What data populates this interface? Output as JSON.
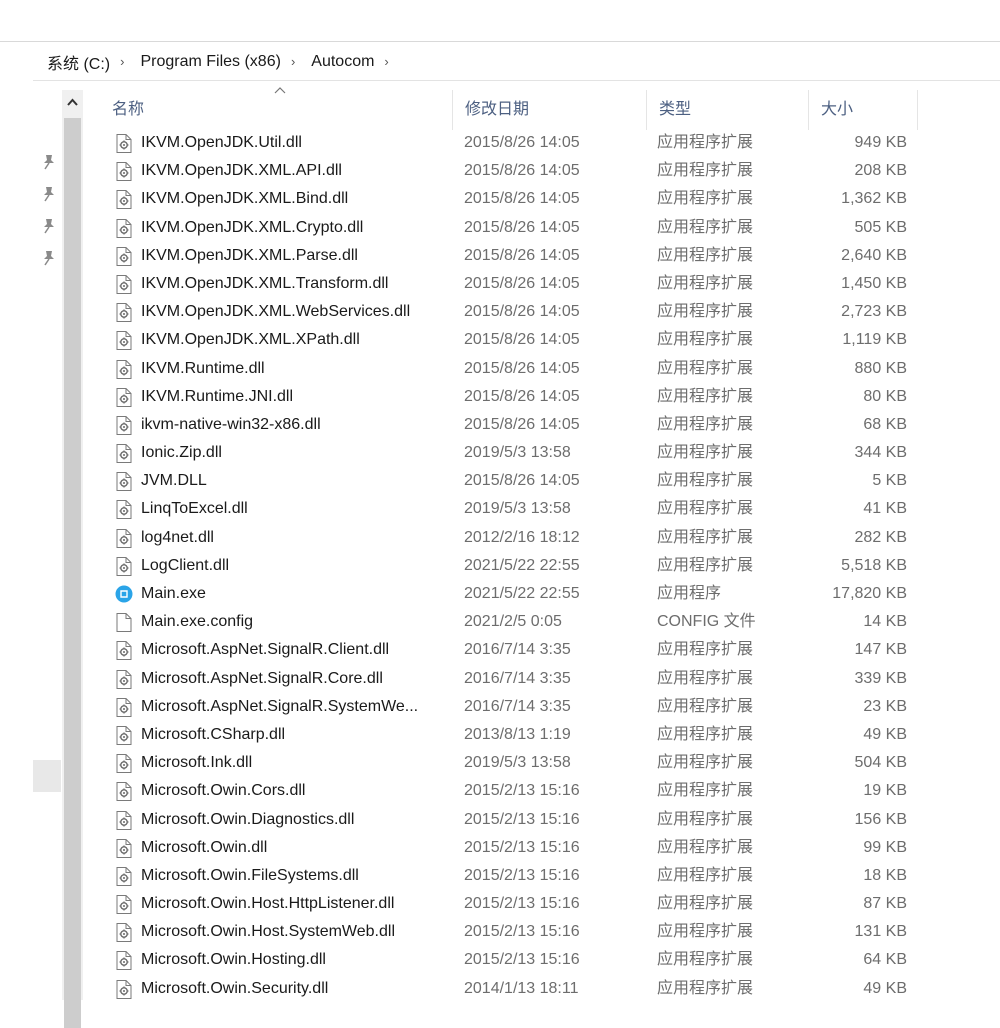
{
  "breadcrumb": {
    "items": [
      "系统 (C:)",
      "Program Files (x86)",
      "Autocom"
    ],
    "separator": "›"
  },
  "header": {
    "name": "名称",
    "date": "修改日期",
    "type": "类型",
    "size": "大小"
  },
  "colors": {
    "header_text": "#4d6082",
    "meta_text": "#6d6d6d",
    "exe_icon": "#2aa4e8"
  },
  "files": [
    {
      "name": "IKVM.OpenJDK.Util.dll",
      "date": "2015/8/26 14:05",
      "type": "应用程序扩展",
      "size": "949 KB",
      "icon": "dll-icon"
    },
    {
      "name": "IKVM.OpenJDK.XML.API.dll",
      "date": "2015/8/26 14:05",
      "type": "应用程序扩展",
      "size": "208 KB",
      "icon": "dll-icon"
    },
    {
      "name": "IKVM.OpenJDK.XML.Bind.dll",
      "date": "2015/8/26 14:05",
      "type": "应用程序扩展",
      "size": "1,362 KB",
      "icon": "dll-icon"
    },
    {
      "name": "IKVM.OpenJDK.XML.Crypto.dll",
      "date": "2015/8/26 14:05",
      "type": "应用程序扩展",
      "size": "505 KB",
      "icon": "dll-icon"
    },
    {
      "name": "IKVM.OpenJDK.XML.Parse.dll",
      "date": "2015/8/26 14:05",
      "type": "应用程序扩展",
      "size": "2,640 KB",
      "icon": "dll-icon"
    },
    {
      "name": "IKVM.OpenJDK.XML.Transform.dll",
      "date": "2015/8/26 14:05",
      "type": "应用程序扩展",
      "size": "1,450 KB",
      "icon": "dll-icon"
    },
    {
      "name": "IKVM.OpenJDK.XML.WebServices.dll",
      "date": "2015/8/26 14:05",
      "type": "应用程序扩展",
      "size": "2,723 KB",
      "icon": "dll-icon"
    },
    {
      "name": "IKVM.OpenJDK.XML.XPath.dll",
      "date": "2015/8/26 14:05",
      "type": "应用程序扩展",
      "size": "1,119 KB",
      "icon": "dll-icon"
    },
    {
      "name": "IKVM.Runtime.dll",
      "date": "2015/8/26 14:05",
      "type": "应用程序扩展",
      "size": "880 KB",
      "icon": "dll-icon"
    },
    {
      "name": "IKVM.Runtime.JNI.dll",
      "date": "2015/8/26 14:05",
      "type": "应用程序扩展",
      "size": "80 KB",
      "icon": "dll-icon"
    },
    {
      "name": "ikvm-native-win32-x86.dll",
      "date": "2015/8/26 14:05",
      "type": "应用程序扩展",
      "size": "68 KB",
      "icon": "dll-icon"
    },
    {
      "name": "Ionic.Zip.dll",
      "date": "2019/5/3 13:58",
      "type": "应用程序扩展",
      "size": "344 KB",
      "icon": "dll-icon"
    },
    {
      "name": "JVM.DLL",
      "date": "2015/8/26 14:05",
      "type": "应用程序扩展",
      "size": "5 KB",
      "icon": "dll-icon"
    },
    {
      "name": "LinqToExcel.dll",
      "date": "2019/5/3 13:58",
      "type": "应用程序扩展",
      "size": "41 KB",
      "icon": "dll-icon"
    },
    {
      "name": "log4net.dll",
      "date": "2012/2/16 18:12",
      "type": "应用程序扩展",
      "size": "282 KB",
      "icon": "dll-icon"
    },
    {
      "name": "LogClient.dll",
      "date": "2021/5/22 22:55",
      "type": "应用程序扩展",
      "size": "5,518 KB",
      "icon": "dll-icon"
    },
    {
      "name": "Main.exe",
      "date": "2021/5/22 22:55",
      "type": "应用程序",
      "size": "17,820 KB",
      "icon": "exe-icon"
    },
    {
      "name": "Main.exe.config",
      "date": "2021/2/5 0:05",
      "type": "CONFIG 文件",
      "size": "14 KB",
      "icon": "file-icon"
    },
    {
      "name": "Microsoft.AspNet.SignalR.Client.dll",
      "date": "2016/7/14 3:35",
      "type": "应用程序扩展",
      "size": "147 KB",
      "icon": "dll-icon"
    },
    {
      "name": "Microsoft.AspNet.SignalR.Core.dll",
      "date": "2016/7/14 3:35",
      "type": "应用程序扩展",
      "size": "339 KB",
      "icon": "dll-icon"
    },
    {
      "name": "Microsoft.AspNet.SignalR.SystemWe...",
      "date": "2016/7/14 3:35",
      "type": "应用程序扩展",
      "size": "23 KB",
      "icon": "dll-icon"
    },
    {
      "name": "Microsoft.CSharp.dll",
      "date": "2013/8/13 1:19",
      "type": "应用程序扩展",
      "size": "49 KB",
      "icon": "dll-icon"
    },
    {
      "name": "Microsoft.Ink.dll",
      "date": "2019/5/3 13:58",
      "type": "应用程序扩展",
      "size": "504 KB",
      "icon": "dll-icon"
    },
    {
      "name": "Microsoft.Owin.Cors.dll",
      "date": "2015/2/13 15:16",
      "type": "应用程序扩展",
      "size": "19 KB",
      "icon": "dll-icon"
    },
    {
      "name": "Microsoft.Owin.Diagnostics.dll",
      "date": "2015/2/13 15:16",
      "type": "应用程序扩展",
      "size": "156 KB",
      "icon": "dll-icon"
    },
    {
      "name": "Microsoft.Owin.dll",
      "date": "2015/2/13 15:16",
      "type": "应用程序扩展",
      "size": "99 KB",
      "icon": "dll-icon"
    },
    {
      "name": "Microsoft.Owin.FileSystems.dll",
      "date": "2015/2/13 15:16",
      "type": "应用程序扩展",
      "size": "18 KB",
      "icon": "dll-icon"
    },
    {
      "name": "Microsoft.Owin.Host.HttpListener.dll",
      "date": "2015/2/13 15:16",
      "type": "应用程序扩展",
      "size": "87 KB",
      "icon": "dll-icon"
    },
    {
      "name": "Microsoft.Owin.Host.SystemWeb.dll",
      "date": "2015/2/13 15:16",
      "type": "应用程序扩展",
      "size": "131 KB",
      "icon": "dll-icon"
    },
    {
      "name": "Microsoft.Owin.Hosting.dll",
      "date": "2015/2/13 15:16",
      "type": "应用程序扩展",
      "size": "64 KB",
      "icon": "dll-icon"
    },
    {
      "name": "Microsoft.Owin.Security.dll",
      "date": "2014/1/13 18:11",
      "type": "应用程序扩展",
      "size": "49 KB",
      "icon": "dll-icon"
    }
  ]
}
